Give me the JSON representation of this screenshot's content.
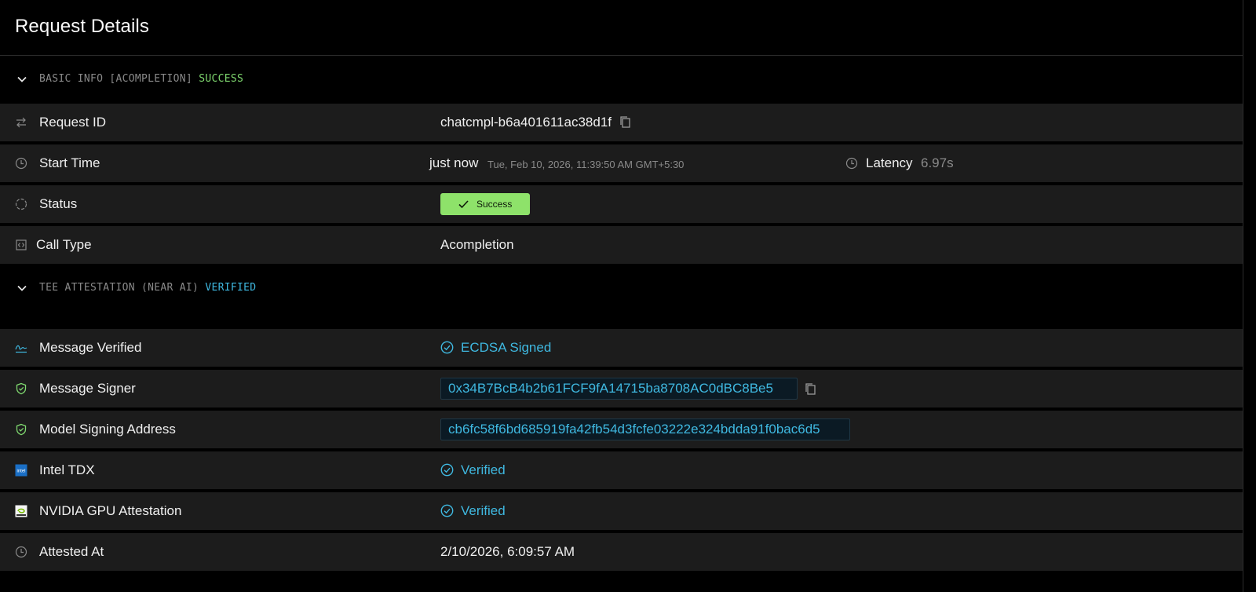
{
  "page": {
    "title": "Request Details"
  },
  "basic_info": {
    "section_label": "BASIC INFO [ACOMPLETION]",
    "section_status": "SUCCESS",
    "request_id": {
      "label": "Request ID",
      "value": "chatcmpl-b6a401611ac38d1f",
      "icon": "arrows-swap-icon"
    },
    "start_time": {
      "label": "Start Time",
      "relative": "just now",
      "absolute": "Tue, Feb 10, 2026, 11:39:50 AM GMT+5:30",
      "icon": "clock-icon"
    },
    "latency": {
      "label": "Latency",
      "value": "6.97s",
      "icon": "clock-icon"
    },
    "status": {
      "label": "Status",
      "value": "Success",
      "icon": "status-circle-icon"
    },
    "call_type": {
      "label": "Call Type",
      "value": "Acompletion",
      "icon": "code-box-icon"
    }
  },
  "tee_attestation": {
    "section_label": "TEE ATTESTATION (NEAR AI)",
    "section_status": "VERIFIED",
    "message_verified": {
      "label": "Message Verified",
      "value": "ECDSA Signed",
      "icon": "signature-icon"
    },
    "message_signer": {
      "label": "Message Signer",
      "value": "0x34B7BcB4b2b61FCF9fA14715ba8708AC0dBC8Be5",
      "icon": "shield-check-icon"
    },
    "model_signing_address": {
      "label": "Model Signing Address",
      "value": "cb6fc58f6bd685919fa42fb54d3fcfe03222e324bdda91f0bac6d5",
      "icon": "shield-check-icon"
    },
    "intel_tdx": {
      "label": "Intel TDX",
      "value": "Verified",
      "icon": "intel-logo-icon"
    },
    "nvidia_gpu": {
      "label": "NVIDIA GPU Attestation",
      "value": "Verified",
      "icon": "nvidia-logo-icon"
    },
    "attested_at": {
      "label": "Attested At",
      "value": "2/10/2026, 6:09:57 AM",
      "icon": "clock-icon"
    }
  },
  "colors": {
    "background": "#000000",
    "row": "#1c1c1c",
    "success_green": "#8ee26a",
    "verified_blue": "#3fb8e0",
    "muted": "#8a8a8a"
  }
}
